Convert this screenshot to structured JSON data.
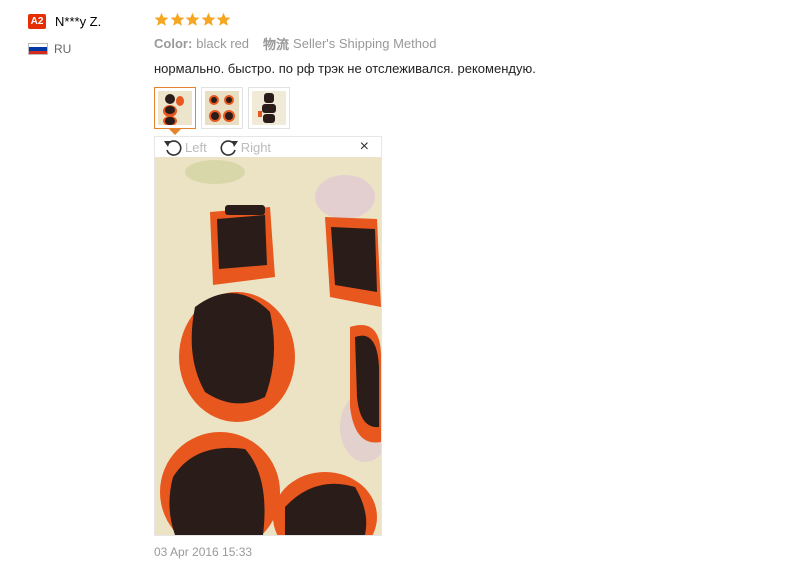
{
  "user": {
    "level": "A2",
    "name": "N***y Z.",
    "country": "RU"
  },
  "review": {
    "rating": 5,
    "color_key": "Color:",
    "color_value": "black red",
    "shipping_key": "物流",
    "shipping_value": "Seller's Shipping Method",
    "text": "нормально. быстро. по рф трэк не отслеживался. рекомендую.",
    "photo_count": 3,
    "date": "03 Apr 2016 15:33"
  },
  "viewer": {
    "rotate_left_label": "Left",
    "rotate_right_label": "Right",
    "close_glyph": "×"
  },
  "colors": {
    "star": "#f5a623",
    "badge": "#e62e04",
    "active_thumb": "#e5842c",
    "pad_orange": "#e8571e"
  }
}
